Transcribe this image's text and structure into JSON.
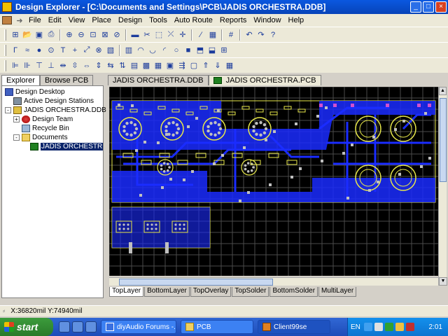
{
  "window": {
    "title": "Design Explorer - [C:\\Documents and Settings\\PCB\\JADIS ORCHESTRA.DDB]",
    "min": "_",
    "max": "□",
    "close": "×"
  },
  "menu": {
    "items": [
      "File",
      "Edit",
      "View",
      "Place",
      "Design",
      "Tools",
      "Auto Route",
      "Reports",
      "Window",
      "Help"
    ]
  },
  "left_panel": {
    "tabs": [
      "Explorer",
      "Browse PCB"
    ],
    "tree": [
      {
        "label": "Design Desktop",
        "icon": "desktop-icon"
      },
      {
        "label": "Active Design Stations",
        "icon": "station-icon"
      },
      {
        "label": "JADIS ORCHESTRA.DDB",
        "icon": "database-icon",
        "expander": "-"
      },
      {
        "label": "Design Team",
        "icon": "team-icon",
        "expander": "+"
      },
      {
        "label": "Recycle Bin",
        "icon": "recycle-bin-icon"
      },
      {
        "label": "Documents",
        "icon": "folder-icon",
        "expander": "-"
      },
      {
        "label": "JADIS ORCHESTR",
        "icon": "pcb-icon"
      }
    ]
  },
  "documents": {
    "tabs": [
      "JADIS ORCHESTRA.DDB",
      "JADIS ORCHESTRA.PCB"
    ],
    "layer_tabs": [
      "TopLayer",
      "BottomLayer",
      "TopOverlay",
      "TopSolder",
      "BottomSolder",
      "MultiLayer"
    ]
  },
  "status": {
    "coordinates": "X:36820mil Y:74940mil"
  },
  "taskbar": {
    "start": "start",
    "tasks": [
      "diyAudio Forums -...",
      "PCB",
      "Client99se"
    ],
    "language": "EN",
    "clock": "2:01"
  },
  "colors": {
    "trace_blue": "#1a2cff",
    "outline_yellow": "#e8e84a",
    "pad_silver": "#c0c0c0",
    "grid": "#4a4a4a"
  }
}
